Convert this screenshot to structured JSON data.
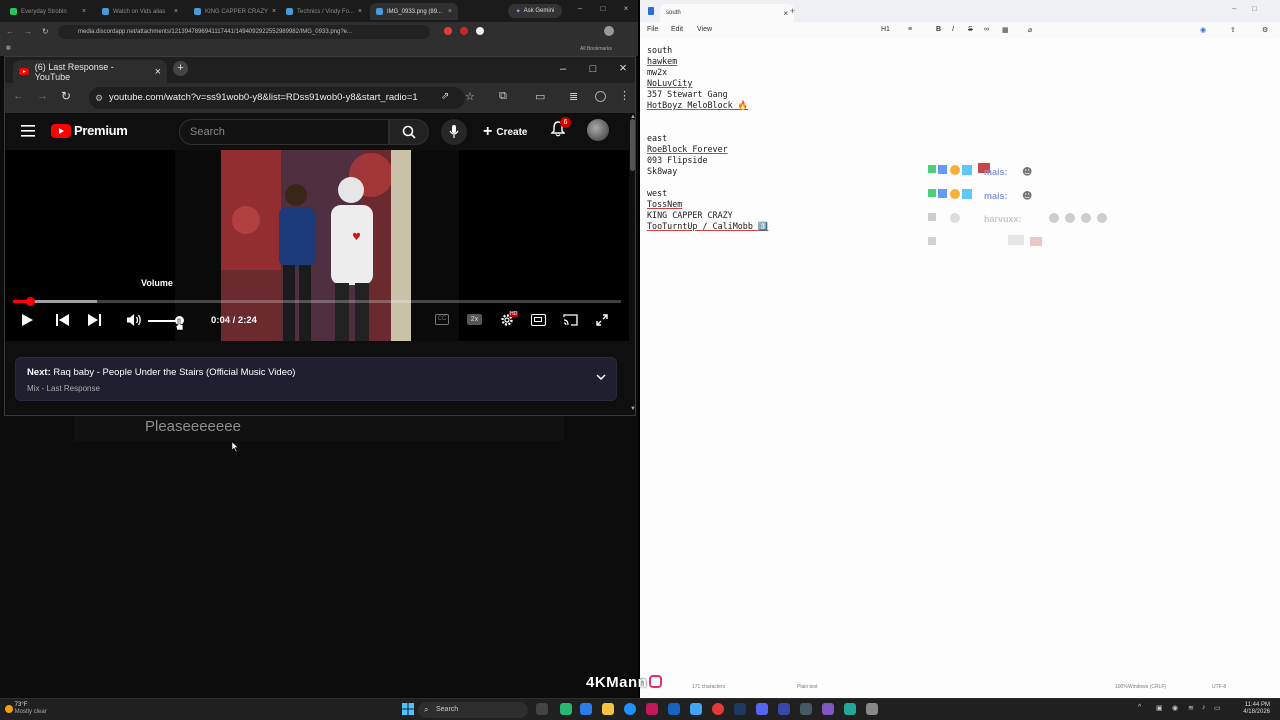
{
  "bg_browser": {
    "tabs": [
      "Everyday Strobin",
      "Watch on Vids alias",
      "KING CAPPER CRAZY",
      "Technics / Vindy Fo...",
      "IMG_0933.png (89..."
    ],
    "ask_gemini": "Ask Gemini",
    "url": "media.discordapp.net/attachments/1213947896941117441/1494092922552989982/IMG_0933.png?e...",
    "bookmarks": "All Bookmarks",
    "caption": "Pleaseeeeeee"
  },
  "youtube": {
    "tab_title": "(6) Last Response - YouTube",
    "url": "youtube.com/watch?v=ss91wob0-y8&list=RDss91wob0-y8&start_radio=1",
    "logo_text": "Premium",
    "search_placeholder": "Search",
    "create_label": "Create",
    "notif_count": "6",
    "volume_tooltip": "Volume",
    "time": "0:04 / 2:24",
    "progress_fraction": 0.028,
    "speed_badge": "2x",
    "hd_badge": "HD",
    "next_prefix": "Next:",
    "next_title": "Raq baby - People Under the Stairs (Official Music Video)",
    "next_subtitle": "Mix - Last Response"
  },
  "notepad": {
    "tab_title": "south",
    "menu": [
      "File",
      "Edit",
      "View"
    ],
    "format": "H1",
    "lines": [
      {
        "text": "south",
        "u": false
      },
      {
        "text": "hawkem",
        "u": true
      },
      {
        "text": "mw2x",
        "u": false
      },
      {
        "text": "NoLuvCity",
        "u": true
      },
      {
        "text": "357 Stewart Gang",
        "u": false
      },
      {
        "text": "HotBoyz MeloBlock 🔥",
        "u": true
      },
      {
        "text": "",
        "u": false
      },
      {
        "text": "",
        "u": false
      },
      {
        "text": "east",
        "u": false
      },
      {
        "text": "RoeBlock Forever",
        "u": true
      },
      {
        "text": "093 Flipside",
        "u": false
      },
      {
        "text": "Sk8way",
        "u": false
      },
      {
        "text": "",
        "u": false
      },
      {
        "text": "west",
        "u": false
      },
      {
        "text": "TossNem",
        "u": true
      },
      {
        "text": "KING CAPPER CRAZY",
        "u": false
      },
      {
        "text": "TooTurntUp / CaliMobb 3️⃣",
        "u": true
      }
    ],
    "status": {
      "chars": "171 characters",
      "type": "Plain text",
      "zoom": "100%",
      "eol": "Windows (CRLF)",
      "enc": "UTF-8"
    },
    "ghost_names": [
      "mais:",
      "mais:",
      "harvuxx:"
    ]
  },
  "taskbar": {
    "weather_temp": "73°F",
    "weather_desc": "Mostly clear",
    "search": "Search",
    "time": "11:44 PM",
    "date": "4/18/2026"
  },
  "watermark": "4KMann"
}
